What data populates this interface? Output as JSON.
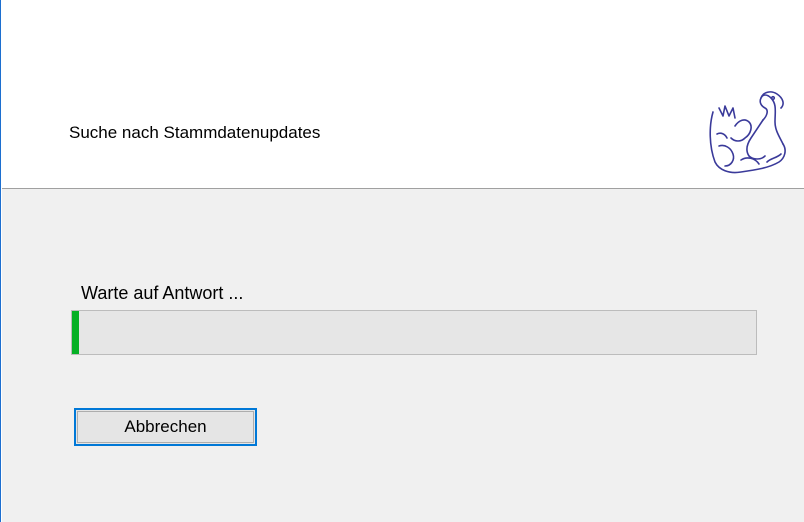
{
  "header": {
    "title": "Suche nach Stammdatenupdates",
    "logo_icon": "dragon-logo-icon"
  },
  "main": {
    "status": "Warte auf Antwort ...",
    "progress": {
      "value_percent": 1,
      "color": "#06b025"
    },
    "cancel_button": {
      "label": "Abbrechen"
    }
  },
  "colors": {
    "accent": "#0078d7",
    "content_background": "#f0f0f0"
  }
}
